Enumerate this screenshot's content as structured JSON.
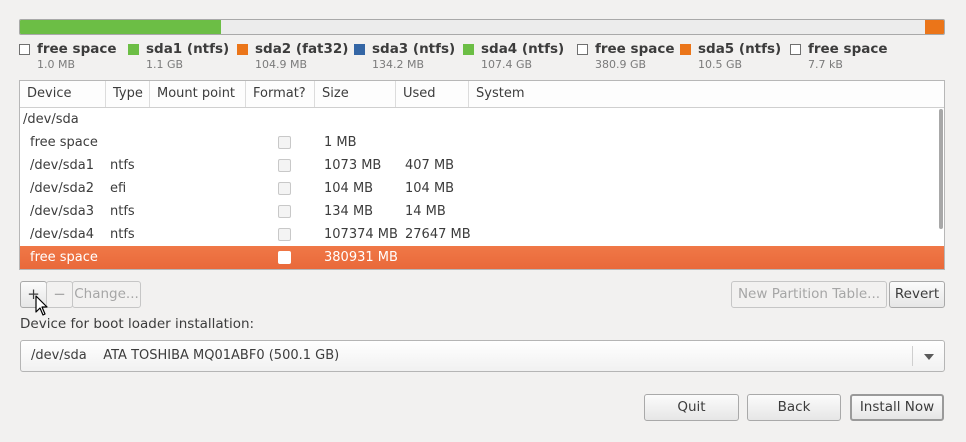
{
  "partition_bar": {
    "segments": [
      {
        "name": "free space",
        "fraction": 2e-06,
        "color": "#f2f2f2"
      },
      {
        "name": "sda1",
        "fraction": 0.0021,
        "color": "#6cbe45"
      },
      {
        "name": "sda2",
        "fraction": 0.0002,
        "color": "#eb7519"
      },
      {
        "name": "sda3",
        "fraction": 0.0003,
        "color": "#3466a5"
      },
      {
        "name": "sda4",
        "fraction": 0.2147,
        "color": "#6cbe45"
      },
      {
        "name": "free space",
        "fraction": 0.7617,
        "color": "#ececec"
      },
      {
        "name": "sda5",
        "fraction": 0.021,
        "color": "#eb7519"
      },
      {
        "name": "free space",
        "fraction": 1.54e-05,
        "color": "#f2f2f2"
      }
    ]
  },
  "legend": [
    {
      "name": "free space",
      "size": "1.0 MB",
      "color": "#ffffff"
    },
    {
      "name": "sda1 (ntfs)",
      "size": "1.1 GB",
      "color": "#6cbe45"
    },
    {
      "name": "sda2 (fat32)",
      "size": "104.9 MB",
      "color": "#eb7519"
    },
    {
      "name": "sda3 (ntfs)",
      "size": "134.2 MB",
      "color": "#3466a5"
    },
    {
      "name": "sda4 (ntfs)",
      "size": "107.4 GB",
      "color": "#6cbe45"
    },
    {
      "name": "free space",
      "size": "380.9 GB",
      "color": "#ffffff"
    },
    {
      "name": "sda5 (ntfs)",
      "size": "10.5 GB",
      "color": "#eb7519"
    },
    {
      "name": "free space",
      "size": "7.7 kB",
      "color": "#ffffff"
    }
  ],
  "table": {
    "columns": [
      "Device",
      "Type",
      "Mount point",
      "Format?",
      "Size",
      "Used",
      "System"
    ],
    "group": "/dev/sda",
    "rows": [
      {
        "device": "free space",
        "type": "",
        "mount": "",
        "size": "1 MB",
        "used": "",
        "system": "",
        "selected": false
      },
      {
        "device": "/dev/sda1",
        "type": "ntfs",
        "mount": "",
        "size": "1073 MB",
        "used": "407 MB",
        "system": "",
        "selected": false
      },
      {
        "device": "/dev/sda2",
        "type": "efi",
        "mount": "",
        "size": "104 MB",
        "used": "104 MB",
        "system": "",
        "selected": false
      },
      {
        "device": "/dev/sda3",
        "type": "ntfs",
        "mount": "",
        "size": "134 MB",
        "used": "14 MB",
        "system": "",
        "selected": false
      },
      {
        "device": "/dev/sda4",
        "type": "ntfs",
        "mount": "",
        "size": "107374 MB",
        "used": "27647 MB",
        "system": "",
        "selected": false
      },
      {
        "device": "free space",
        "type": "",
        "mount": "",
        "size": "380931 MB",
        "used": "",
        "system": "",
        "selected": true
      }
    ]
  },
  "toolbar": {
    "add_label": "+",
    "remove_label": "−",
    "change_label": "Change...",
    "new_table_label": "New Partition Table...",
    "revert_label": "Revert"
  },
  "boot": {
    "label": "Device for boot loader installation:",
    "selected": "/dev/sda    ATA TOSHIBA MQ01ABF0 (500.1 GB)"
  },
  "footer": {
    "quit_label": "Quit",
    "back_label": "Back",
    "install_label": "Install Now"
  }
}
